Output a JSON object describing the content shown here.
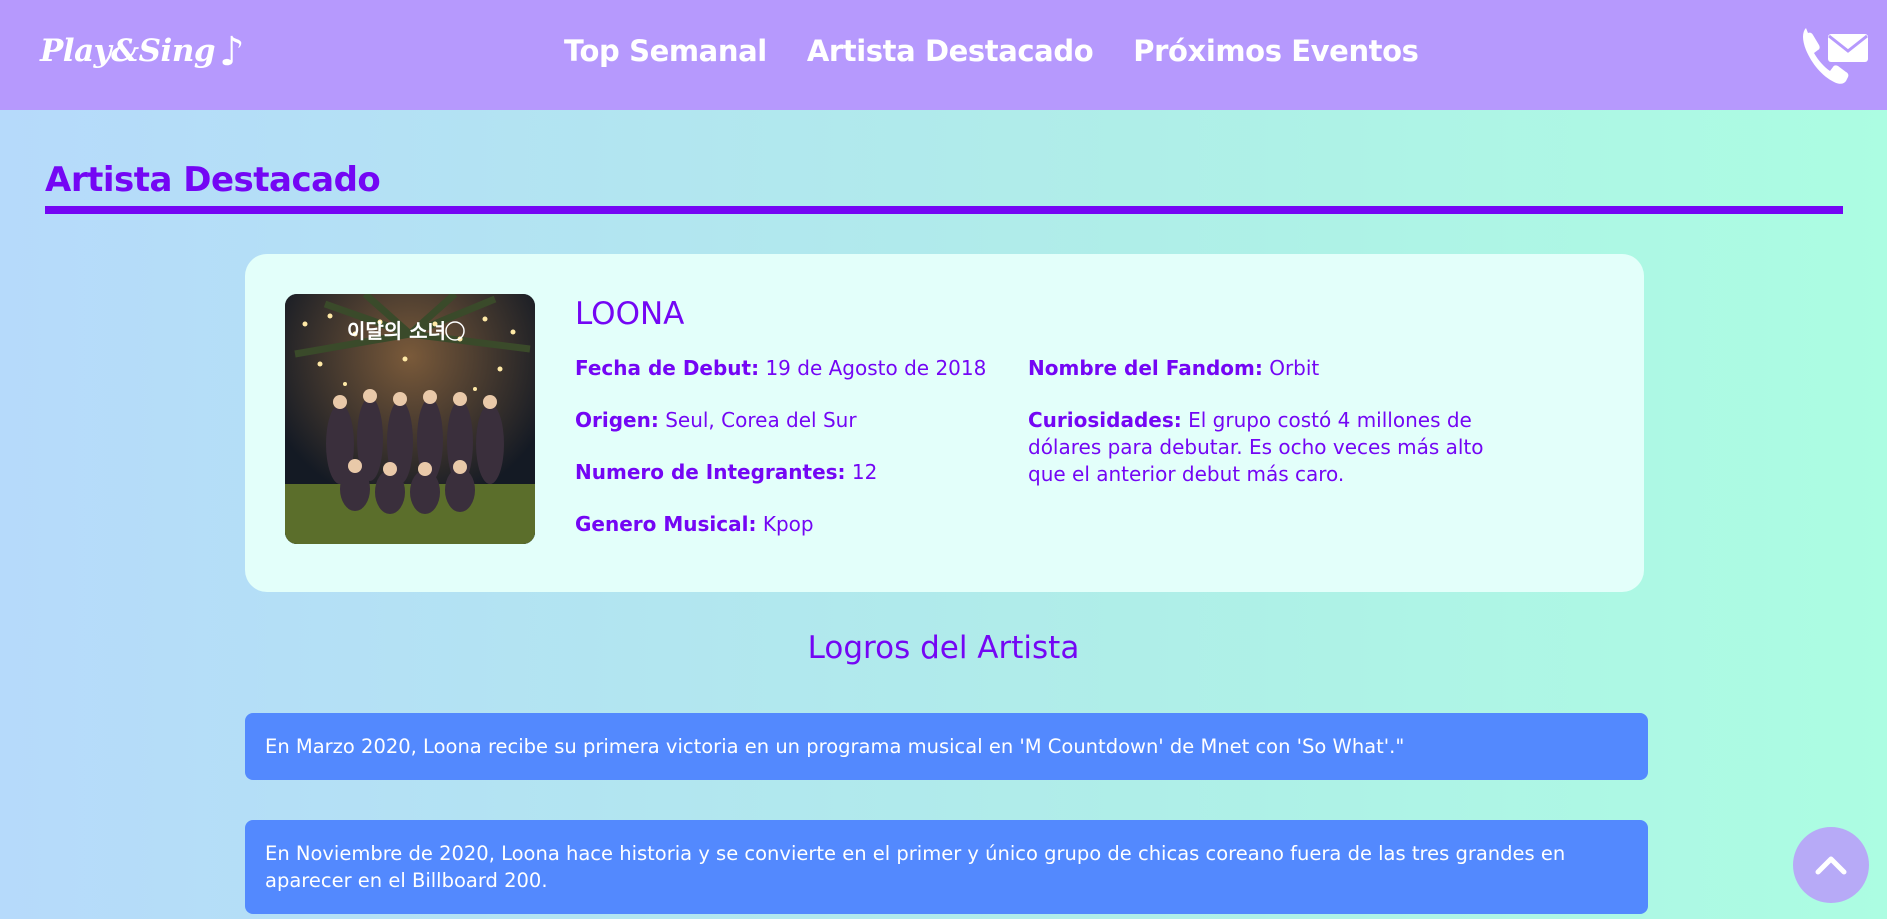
{
  "header": {
    "brand": "Play&Sing",
    "brand_note": "♪",
    "nav": [
      {
        "label": "Top Semanal"
      },
      {
        "label": "Artista Destacado"
      },
      {
        "label": "Próximos Eventos"
      }
    ],
    "contact_icon": "phone-mail-icon"
  },
  "main": {
    "title": "Artista Destacado",
    "artist": {
      "name": "LOONA",
      "photo_caption": "이달의 소녀",
      "fields": [
        {
          "label": "Fecha de Debut:",
          "value": "19 de Agosto de 2018"
        },
        {
          "label": "Origen:",
          "value": "Seul, Corea del Sur"
        },
        {
          "label": "Numero de Integrantes:",
          "value": "12"
        },
        {
          "label": "Genero Musical:",
          "value": "Kpop"
        }
      ],
      "fields_right": [
        {
          "label": "Nombre del Fandom:",
          "value": "Orbit"
        },
        {
          "label": "Curiosidades:",
          "value": "El grupo costó 4 millones de dólares para debutar. Es ocho veces más alto que el anterior debut más caro."
        }
      ]
    },
    "achievements_title": "Logros del Artista",
    "achievements": [
      "En Marzo 2020, Loona recibe su primera victoria en un programa musical en 'M Countdown' de Mnet con 'So What'.\"",
      "En Noviembre de 2020, Loona hace historia y se convierte en el primer y único grupo de chicas coreano fuera de las tres grandes en aparecer en el Billboard 200."
    ]
  },
  "scroll_top_icon": "chevron-up-icon",
  "colors": {
    "navbar": "#b699fd",
    "accent_purple": "#7406f4",
    "card": "#e3fffa",
    "achievement": "#5389fe",
    "scroll_button": "#b7aaf7"
  }
}
